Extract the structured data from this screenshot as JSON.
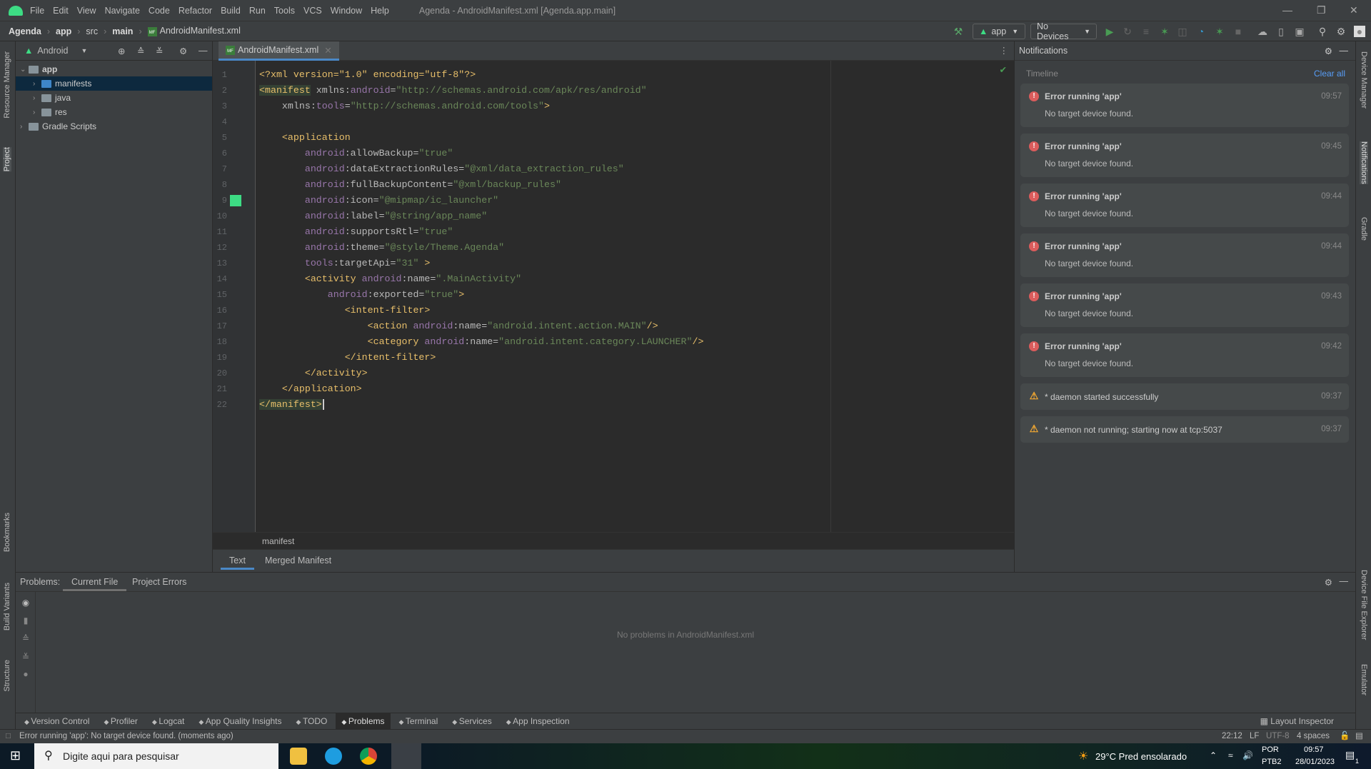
{
  "menubar": {
    "items": [
      "File",
      "Edit",
      "View",
      "Navigate",
      "Code",
      "Refactor",
      "Build",
      "Run",
      "Tools",
      "VCS",
      "Window",
      "Help"
    ],
    "title": "Agenda - AndroidManifest.xml [Agenda.app.main]"
  },
  "navbar": {
    "crumbs": [
      "Agenda",
      "app",
      "src",
      "main",
      "AndroidManifest.xml"
    ]
  },
  "toolbar": {
    "run_config": "app",
    "device": "No Devices"
  },
  "project": {
    "view": "Android",
    "tree": [
      {
        "label": "app",
        "level": 0,
        "expanded": true
      },
      {
        "label": "manifests",
        "level": 1,
        "selected": true
      },
      {
        "label": "java",
        "level": 1
      },
      {
        "label": "res",
        "level": 1
      },
      {
        "label": "Gradle Scripts",
        "level": 0
      }
    ]
  },
  "left_strip": [
    "Resource Manager",
    "Project",
    "Bookmarks",
    "Build Variants",
    "Structure"
  ],
  "right_strip": [
    "Device Manager",
    "Notifications",
    "Gradle",
    "Device File Explorer",
    "Emulator"
  ],
  "editor": {
    "tab": "AndroidManifest.xml",
    "breadcrumb": "manifest",
    "bottom_tabs": [
      "Text",
      "Merged Manifest"
    ],
    "active_bottom_tab": "Text",
    "lines": [
      [
        [
          "pi",
          "<?xml version=\"1.0\" encoding=\"utf-8\"?>"
        ]
      ],
      [
        [
          "tag hl",
          "<manifest"
        ],
        [
          "attr",
          " xmlns:"
        ],
        [
          "ns",
          "android"
        ],
        [
          "attr",
          "="
        ],
        [
          "str",
          "\"http://schemas.android.com/apk/res/android\""
        ]
      ],
      [
        [
          "attr",
          "    xmlns:"
        ],
        [
          "ns",
          "tools"
        ],
        [
          "attr",
          "="
        ],
        [
          "str",
          "\"http://schemas.android.com/tools\""
        ],
        [
          "tag",
          ">"
        ]
      ],
      [],
      [
        [
          "tag",
          "    <application"
        ]
      ],
      [
        [
          "ns",
          "        android"
        ],
        [
          "attr",
          ":allowBackup="
        ],
        [
          "str",
          "\"true\""
        ]
      ],
      [
        [
          "ns",
          "        android"
        ],
        [
          "attr",
          ":dataExtractionRules="
        ],
        [
          "str",
          "\"@xml/data_extraction_rules\""
        ]
      ],
      [
        [
          "ns",
          "        android"
        ],
        [
          "attr",
          ":fullBackupContent="
        ],
        [
          "str",
          "\"@xml/backup_rules\""
        ]
      ],
      [
        [
          "ns",
          "        android"
        ],
        [
          "attr",
          ":icon="
        ],
        [
          "str",
          "\"@mipmap/ic_launcher\""
        ]
      ],
      [
        [
          "ns",
          "        android"
        ],
        [
          "attr",
          ":label="
        ],
        [
          "str",
          "\"@string/app_name\""
        ]
      ],
      [
        [
          "ns",
          "        android"
        ],
        [
          "attr",
          ":supportsRtl="
        ],
        [
          "str",
          "\"true\""
        ]
      ],
      [
        [
          "ns",
          "        android"
        ],
        [
          "attr",
          ":theme="
        ],
        [
          "str",
          "\"@style/Theme.Agenda\""
        ]
      ],
      [
        [
          "ns",
          "        tools"
        ],
        [
          "attr",
          ":targetApi="
        ],
        [
          "str",
          "\"31\""
        ],
        [
          "tag",
          " >"
        ]
      ],
      [
        [
          "tag",
          "        <activity"
        ],
        [
          "ns",
          " android"
        ],
        [
          "attr",
          ":name="
        ],
        [
          "str",
          "\".MainActivity\""
        ]
      ],
      [
        [
          "ns",
          "            android"
        ],
        [
          "attr",
          ":exported="
        ],
        [
          "str",
          "\"true\""
        ],
        [
          "tag",
          ">"
        ]
      ],
      [
        [
          "tag",
          "               <intent-filter>"
        ]
      ],
      [
        [
          "tag",
          "                   <action"
        ],
        [
          "ns",
          " android"
        ],
        [
          "attr",
          ":name="
        ],
        [
          "str",
          "\"android.intent.action.MAIN\""
        ],
        [
          "tag",
          "/>"
        ]
      ],
      [
        [
          "tag",
          "                   <category"
        ],
        [
          "ns",
          " android"
        ],
        [
          "attr",
          ":name="
        ],
        [
          "str",
          "\"android.intent.category.LAUNCHER\""
        ],
        [
          "tag",
          "/>"
        ]
      ],
      [
        [
          "tag",
          "               </intent-filter>"
        ]
      ],
      [
        [
          "tag",
          "        </activity>"
        ]
      ],
      [
        [
          "tag",
          "    </application>"
        ]
      ],
      [
        [
          "tag hl",
          "</manifest>"
        ]
      ]
    ]
  },
  "notifications": {
    "title": "Notifications",
    "timeline": "Timeline",
    "clear_all": "Clear all",
    "items": [
      {
        "type": "error",
        "title": "Error running 'app'",
        "body": "No target device found.",
        "time": "09:57"
      },
      {
        "type": "error",
        "title": "Error running 'app'",
        "body": "No target device found.",
        "time": "09:45"
      },
      {
        "type": "error",
        "title": "Error running 'app'",
        "body": "No target device found.",
        "time": "09:44"
      },
      {
        "type": "error",
        "title": "Error running 'app'",
        "body": "No target device found.",
        "time": "09:44"
      },
      {
        "type": "error",
        "title": "Error running 'app'",
        "body": "No target device found.",
        "time": "09:43"
      },
      {
        "type": "error",
        "title": "Error running 'app'",
        "body": "No target device found.",
        "time": "09:42"
      },
      {
        "type": "warning",
        "title": "* daemon started successfully",
        "time": "09:37"
      },
      {
        "type": "warning",
        "title": "* daemon not running; starting now at tcp:5037",
        "time": "09:37"
      }
    ]
  },
  "problems": {
    "label": "Problems:",
    "tabs": [
      "Current File",
      "Project Errors"
    ],
    "message": "No problems in AndroidManifest.xml"
  },
  "tool_tabs": [
    "Version Control",
    "Profiler",
    "Logcat",
    "App Quality Insights",
    "TODO",
    "Problems",
    "Terminal",
    "Services",
    "App Inspection"
  ],
  "active_tool_tab": "Problems",
  "layout_inspector": "Layout Inspector",
  "status": {
    "message": "Error running 'app': No target device found. (moments ago)",
    "position": "22:12",
    "line_sep": "LF",
    "encoding": "UTF-8",
    "indent": "4 spaces"
  },
  "taskbar": {
    "search_placeholder": "Digite aqui para pesquisar",
    "weather": "29°C  Pred ensolarado",
    "lang": "POR",
    "layout": "PTB2",
    "time": "09:57",
    "date": "28/01/2023",
    "notif_count": "1"
  },
  "colors": {
    "accent": "#4a88c7",
    "error": "#db5c5c",
    "warning": "#f0a732",
    "android_green": "#3ddc84"
  }
}
